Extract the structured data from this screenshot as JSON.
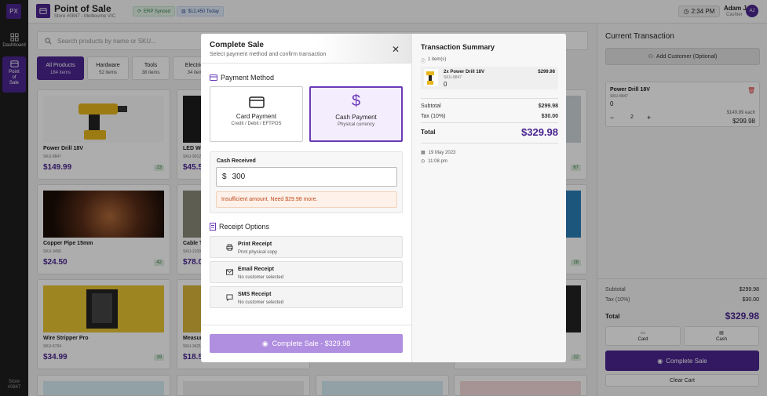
{
  "app": {
    "logo": "PX",
    "title": "Point of Sale",
    "store": "Store #0847 - Melbourne VIC",
    "erp": "ERP Synced",
    "today": "$12,450 Today",
    "time": "2:34 PM",
    "user": "Adam J",
    "role": "Cashier",
    "avatar": "AJ",
    "store_code": "Store",
    "store_num": "#0847"
  },
  "nav": [
    {
      "label": "Dashboard"
    },
    {
      "label": "Point of Sale"
    }
  ],
  "search": {
    "placeholder": "Search products by name or SKU..."
  },
  "categories": [
    {
      "name": "All Products",
      "count": "184 items"
    },
    {
      "name": "Hardware",
      "count": "52 items"
    },
    {
      "name": "Tools",
      "count": "38 items"
    },
    {
      "name": "Electrical",
      "count": "34 items"
    }
  ],
  "products": [
    {
      "name": "Power Drill 18V",
      "sku": "SKU-8847",
      "price": "$149.99",
      "stock": "23"
    },
    {
      "name": "LED Work Light",
      "sku": "SKU-9012",
      "price": "$45.50",
      "stock": ""
    },
    {
      "name": "",
      "sku": "",
      "price": "",
      "stock": "67"
    },
    {
      "name": "Copper Pipe 15mm",
      "sku": "SKU-3456",
      "price": "$24.50",
      "stock": "42"
    },
    {
      "name": "Cable Tie",
      "sku": "SKU-2109",
      "price": "$78.00",
      "stock": ""
    },
    {
      "name": "",
      "sku": "",
      "price": "",
      "stock": "28"
    },
    {
      "name": "Wire Stripper Pro",
      "sku": "SKU-6734",
      "price": "$34.99",
      "stock": "19"
    },
    {
      "name": "Measuring Tape",
      "sku": "SKU-3421",
      "price": "$18.50",
      "stock": ""
    },
    {
      "name": "",
      "sku": "",
      "price": "",
      "stock": "22"
    }
  ],
  "current": {
    "title": "Current Transaction",
    "add_customer": "Add Customer (Optional)",
    "item": {
      "name": "Power Drill 18V",
      "sku": "SKU-8847",
      "zero": "0",
      "qty": "2",
      "each": "$149.99 each",
      "total": "$299.98"
    },
    "subtotal_label": "Subtotal",
    "subtotal": "$299.98",
    "tax_label": "Tax (10%)",
    "tax": "$30.00",
    "total_label": "Total",
    "total": "$329.98",
    "card": "Card",
    "cash": "Cash",
    "complete": "Complete Sale",
    "clear": "Clear Cart"
  },
  "modal": {
    "title": "Complete Sale",
    "subtitle": "Select payment method and confirm transaction",
    "payment_heading": "Payment Method",
    "card_title": "Card Payment",
    "card_sub": "Credit / Debit / EFTPOS",
    "cash_title": "Cash Payment",
    "cash_sub": "Physical currency",
    "cash_label": "Cash Received",
    "currency": "$",
    "cash_value": "300",
    "error": "Insufficient amount. Need $29.98 more.",
    "receipt_heading": "Receipt Options",
    "receipts": [
      {
        "title": "Print Receipt",
        "sub": "Print physical copy"
      },
      {
        "title": "Email Receipt",
        "sub": "No customer selected"
      },
      {
        "title": "SMS Receipt",
        "sub": "No customer selected"
      }
    ],
    "complete": "Complete Sale - $329.98",
    "summary": {
      "title": "Transaction Summary",
      "count": "1 item(s)",
      "item_name": "2x Power Drill 18V",
      "item_sku": "SKU-8847",
      "item_zero": "0",
      "item_price": "$299.98",
      "subtotal_label": "Subtotal",
      "subtotal": "$299.98",
      "tax_label": "Tax (10%)",
      "tax": "$30.00",
      "total_label": "Total",
      "total": "$329.98",
      "date": "19 May 2023",
      "time": "11:08 pm"
    }
  },
  "colors": {
    "brand": "#4a2590",
    "stock_bg": "#dfeee1",
    "error": "#c04a1a"
  }
}
